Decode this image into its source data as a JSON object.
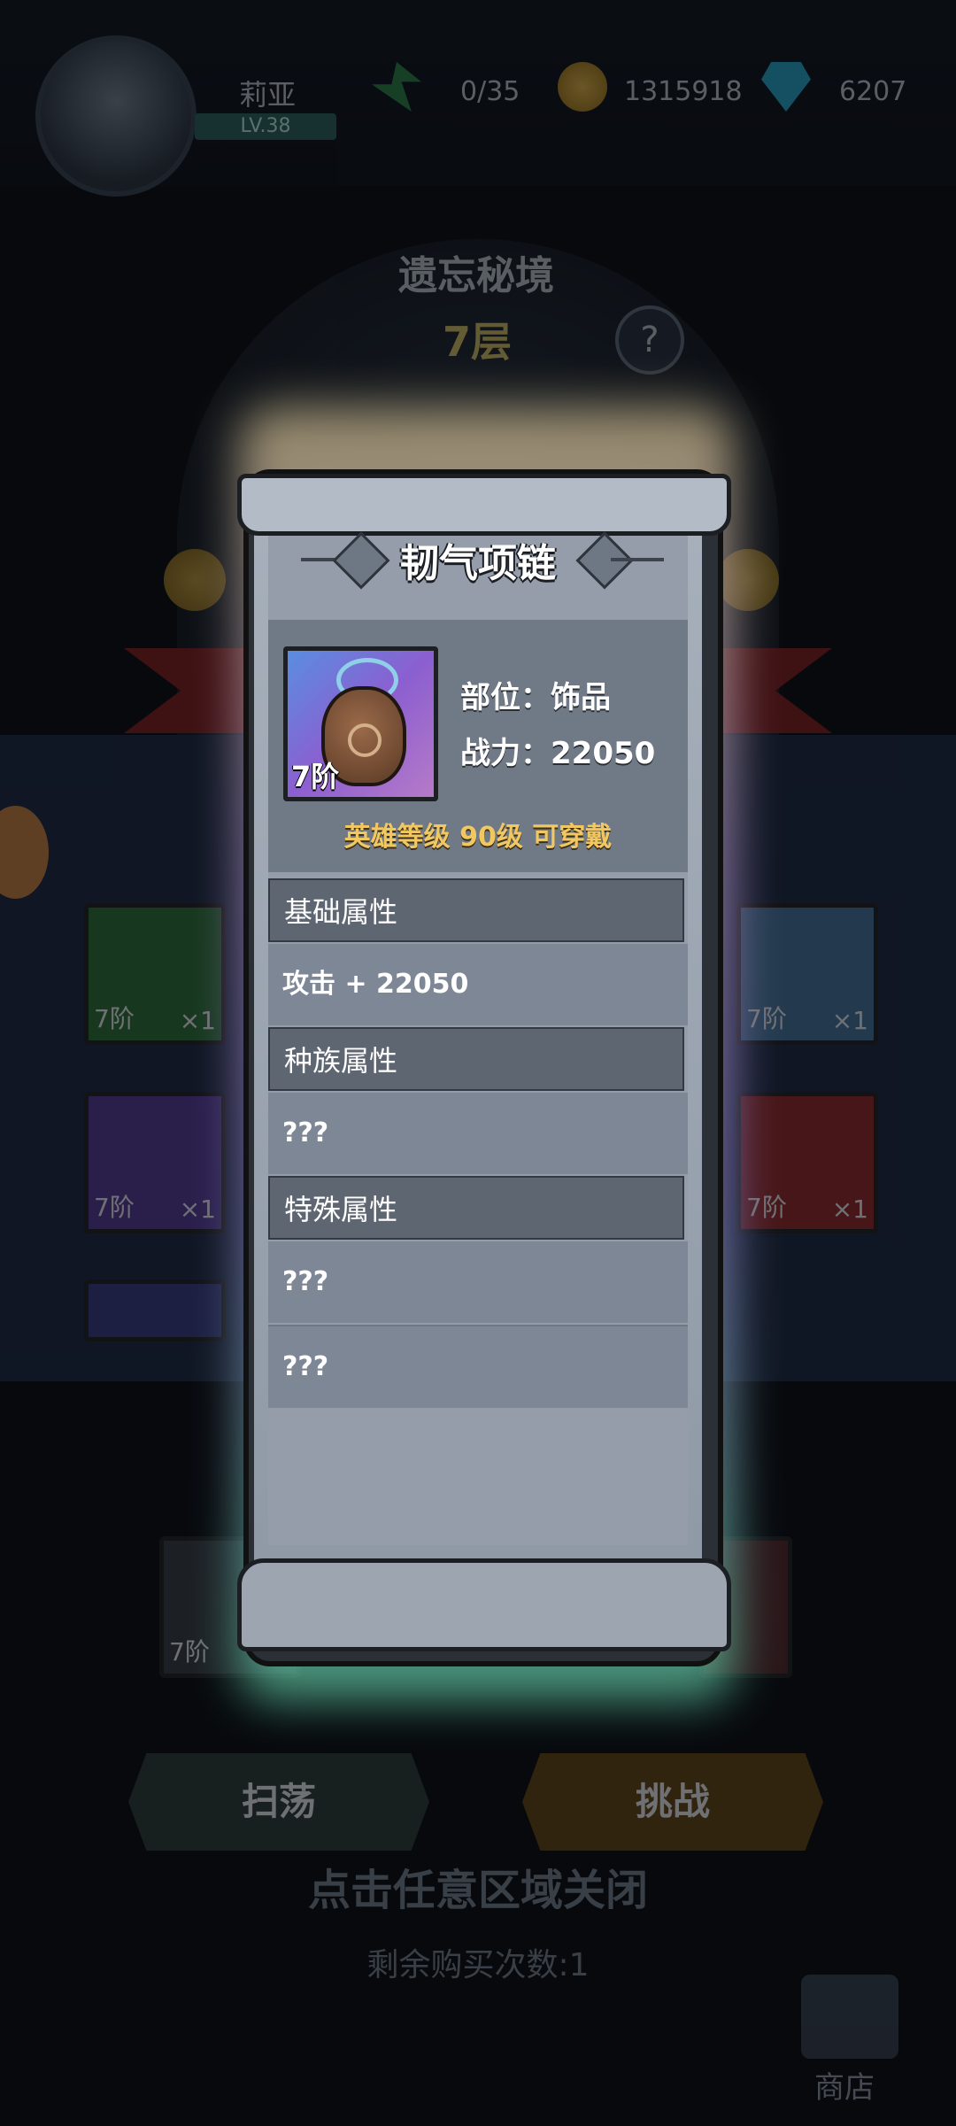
{
  "header": {
    "player_name": "莉亚",
    "player_level": "LV.38",
    "energy": "0/35",
    "gold": "1315918",
    "gems": "6207"
  },
  "dungeon": {
    "title": "遗忘秘境",
    "floor": "7层",
    "help_symbol": "?"
  },
  "background_slots": [
    {
      "tier": "7阶",
      "count": "×1",
      "color": "#2f7a3a"
    },
    {
      "tier": "7阶",
      "count": "×1",
      "color": "#4a7fa8"
    },
    {
      "tier": "7阶",
      "count": "×1",
      "color": "#5b3fa0"
    },
    {
      "tier": "7阶",
      "count": "×1",
      "color": "#a12828"
    },
    {
      "tier": "7阶",
      "count": "",
      "color": "#3a3f8a"
    }
  ],
  "buttons": {
    "sweep": "扫荡",
    "challenge": "挑战",
    "close_hint": "点击任意区域关闭",
    "remaining_buys": "剩余购买次数:1",
    "shop": "商店"
  },
  "item": {
    "name": "韧气项链",
    "tier": "7阶",
    "slot_label": "部位：饰品",
    "power_label": "战力：22050",
    "requirement": "英雄等级  90级  可穿戴",
    "sections": [
      {
        "title": "基础属性",
        "lines": [
          "攻击 + 22050"
        ]
      },
      {
        "title": "种族属性",
        "lines": [
          "???"
        ]
      },
      {
        "title": "特殊属性",
        "lines": [
          "???",
          "???"
        ]
      }
    ]
  }
}
